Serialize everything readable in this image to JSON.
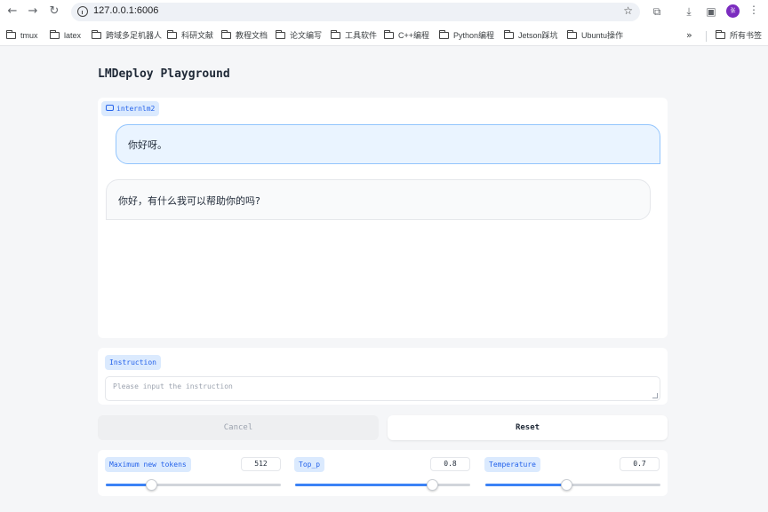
{
  "browser": {
    "url": "127.0.0.1:6006",
    "profile_initials": "张"
  },
  "bookmarks": [
    {
      "label": "tmux"
    },
    {
      "label": "latex"
    },
    {
      "label": "跨域多足机器人"
    },
    {
      "label": "科研文献"
    },
    {
      "label": "教程文档"
    },
    {
      "label": "论文编写"
    },
    {
      "label": "工具软件"
    },
    {
      "label": "C++编程"
    },
    {
      "label": "Python编程"
    },
    {
      "label": "Jetson踩坑"
    },
    {
      "label": "Ubuntu操作"
    }
  ],
  "bookmarks_more": "»",
  "all_bookmarks": "所有书签",
  "app": {
    "title": "LMDeploy Playground",
    "model_label": "internlm2"
  },
  "chat": {
    "messages": [
      {
        "role": "user",
        "text": "你好呀。"
      },
      {
        "role": "assistant",
        "text": "你好，有什么我可以帮助你的吗?"
      }
    ]
  },
  "instruction": {
    "label": "Instruction",
    "placeholder": "Please input the instruction",
    "value": ""
  },
  "buttons": {
    "cancel": "Cancel",
    "reset": "Reset"
  },
  "sliders": [
    {
      "label": "Maximum new tokens",
      "value": "512",
      "fraction": 0.26
    },
    {
      "label": "Top_p",
      "value": "0.8",
      "fraction": 0.78
    },
    {
      "label": "Temperature",
      "value": "0.7",
      "fraction": 0.46
    }
  ],
  "colors": {
    "accent": "#3b82f6",
    "chip_bg": "#dbeafe",
    "chip_text": "#2563eb",
    "user_bubble": "#eaf4ff",
    "user_border": "#93c5fd"
  }
}
